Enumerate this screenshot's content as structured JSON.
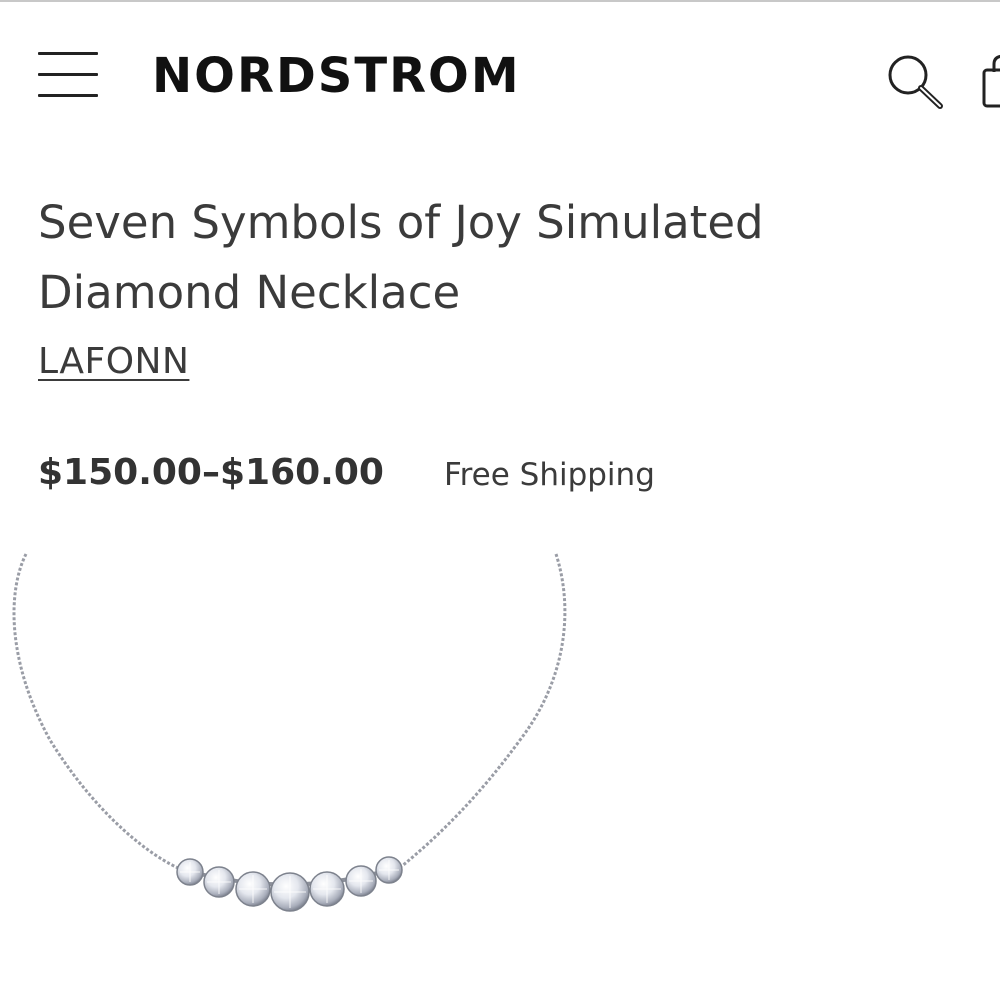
{
  "header": {
    "menu_icon": "hamburger-menu-icon",
    "logo_text": "NORDSTROM",
    "search_icon": "search-icon",
    "bag_icon": "shopping-bag-icon"
  },
  "product": {
    "title": "Seven Symbols of Joy Simulated Diamond Necklace",
    "brand": "LAFONN",
    "price": "$150.00–$160.00",
    "shipping": "Free Shipping",
    "image_icon": "necklace-image"
  }
}
